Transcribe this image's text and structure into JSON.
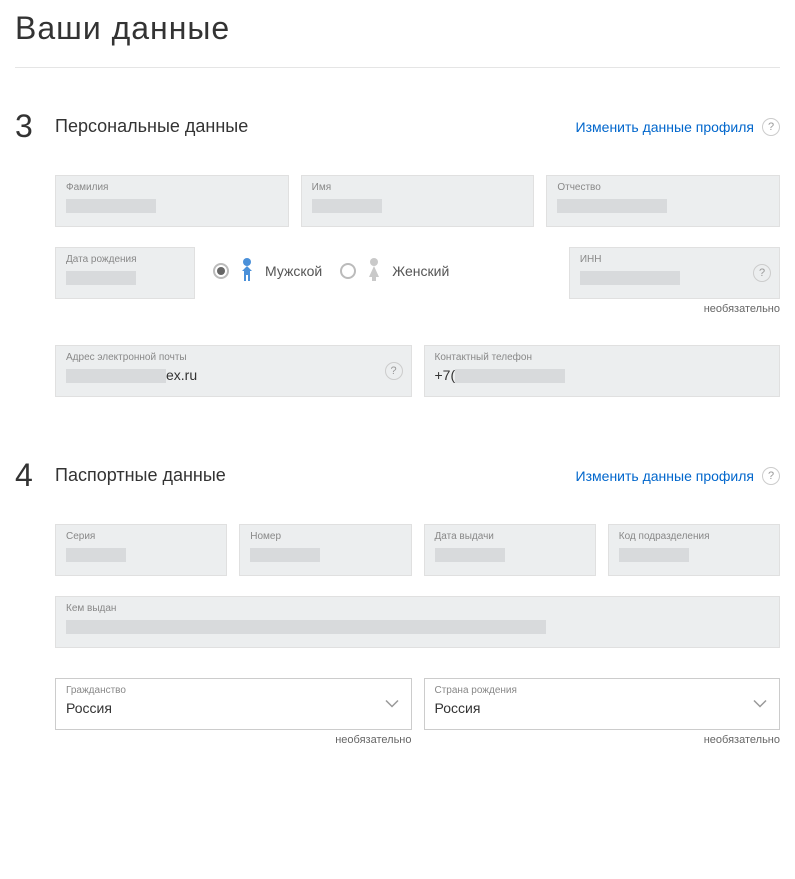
{
  "page_title": "Ваши данные",
  "sections": {
    "personal": {
      "step": "3",
      "title": "Персональные данные",
      "edit_link": "Изменить данные профиля",
      "fields": {
        "lastname_label": "Фамилия",
        "firstname_label": "Имя",
        "patronymic_label": "Отчество",
        "birthdate_label": "Дата рождения",
        "gender_male": "Мужской",
        "gender_female": "Женский",
        "inn_label": "ИНН",
        "inn_hint": "необязательно",
        "email_label": "Адрес электронной почты",
        "email_suffix": "ex.ru",
        "phone_label": "Контактный телефон",
        "phone_prefix": "+7("
      }
    },
    "passport": {
      "step": "4",
      "title": "Паспортные данные",
      "edit_link": "Изменить данные профиля",
      "fields": {
        "series_label": "Серия",
        "number_label": "Номер",
        "issue_date_label": "Дата выдачи",
        "dept_code_label": "Код подразделения",
        "issued_by_label": "Кем выдан",
        "citizenship_label": "Гражданство",
        "citizenship_value": "Россия",
        "citizenship_hint": "необязательно",
        "birth_country_label": "Страна рождения",
        "birth_country_value": "Россия",
        "birth_country_hint": "необязательно"
      }
    }
  },
  "help_char": "?"
}
